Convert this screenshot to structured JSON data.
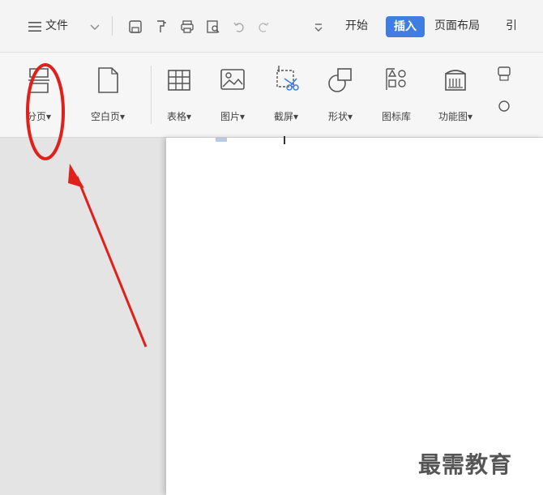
{
  "titlebar": {
    "menu_label": "文件",
    "tabs": [
      {
        "label": "开始"
      },
      {
        "label": "插入",
        "active": true
      },
      {
        "label": "页面布局"
      },
      {
        "label": "引"
      }
    ]
  },
  "ribbon": {
    "buttons": [
      {
        "label": "分页",
        "icon": "page-break-icon",
        "dropdown": true
      },
      {
        "label": "空白页",
        "icon": "blank-page-icon",
        "dropdown": true
      },
      {
        "label": "表格",
        "icon": "table-icon",
        "dropdown": true
      },
      {
        "label": "图片",
        "icon": "picture-icon",
        "dropdown": true
      },
      {
        "label": "截屏",
        "icon": "screenshot-icon",
        "dropdown": true
      },
      {
        "label": "形状",
        "icon": "shape-icon",
        "dropdown": true
      },
      {
        "label": "图标库",
        "icon": "icon-library-icon",
        "dropdown": false
      },
      {
        "label": "功能图",
        "icon": "function-chart-icon",
        "dropdown": true
      }
    ]
  },
  "watermark": "最需教育",
  "colors": {
    "accent": "#3f7de0",
    "annotation": "#e0201a"
  }
}
